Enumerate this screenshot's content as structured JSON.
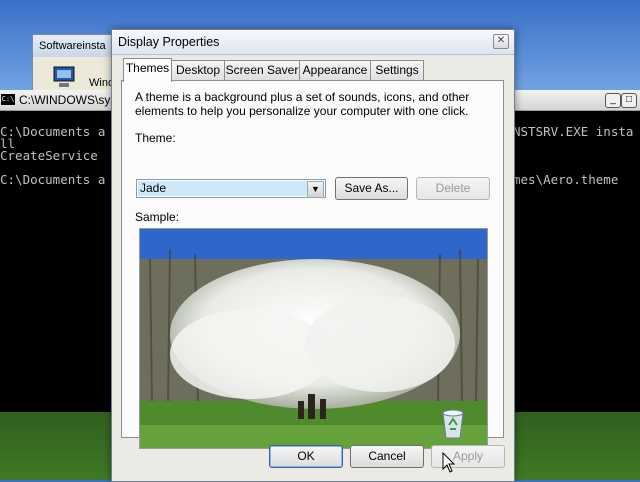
{
  "background_window": {
    "title": "Softwareinsta",
    "label": "Wind"
  },
  "console": {
    "title": "C:\\WINDOWS\\sys",
    "buttons": [
      "_",
      "□"
    ],
    "lines_left": [
      "C:\\Documents a",
      "ll",
      "CreateService",
      "",
      "C:\\Documents a"
    ],
    "lines_right": [
      "NSTSRV.EXE insta",
      "",
      "",
      "",
      "mes\\Aero.theme"
    ],
    "icon_label": "C:\\"
  },
  "dialog": {
    "title": "Display Properties",
    "close_glyph": "✕",
    "tabs": [
      "Themes",
      "Desktop",
      "Screen Saver",
      "Appearance",
      "Settings"
    ],
    "active_tab": "Themes",
    "description": "A theme is a background plus a set of sounds, icons, and other elements to help you personalize your computer with one click.",
    "theme_label": "Theme:",
    "theme_value": "Jade",
    "save_as": "Save As...",
    "delete": "Delete",
    "sample_label": "Sample:",
    "ok": "OK",
    "cancel": "Cancel",
    "apply": "Apply"
  },
  "icons": {
    "dropdown": "chevron-down-icon",
    "recycle_bin": "recycle-bin-icon",
    "cursor": "cursor-icon"
  }
}
